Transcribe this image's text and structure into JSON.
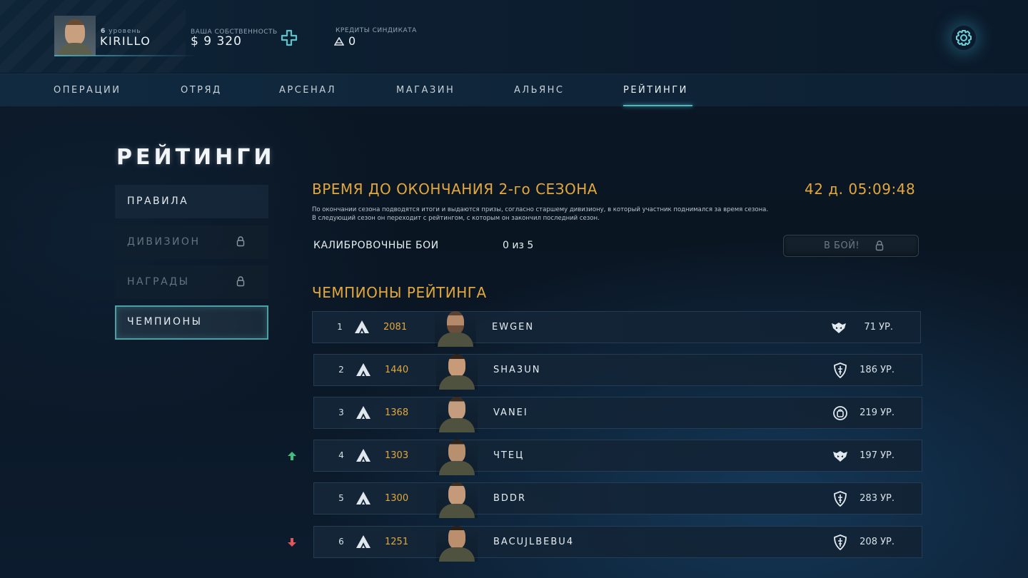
{
  "header": {
    "level_label": "уровень",
    "level_value": "6",
    "player_name": "KIRILLO",
    "property_label": "ВАША СОБСТВЕННОСТЬ",
    "property_value": "$ 9 320",
    "credits_label": "КРЕДИТЫ СИНДИКАТА",
    "credits_value": "0",
    "icons": {
      "add": "plus-icon",
      "credits": "syndicate-credit-icon",
      "settings": "gear-icon"
    }
  },
  "nav": {
    "items": [
      "ОПЕРАЦИИ",
      "ОТРЯД",
      "АРСЕНАЛ",
      "МАГАЗИН",
      "АЛЬЯНС",
      "РЕЙТИНГИ"
    ],
    "active": "РЕЙТИНГИ"
  },
  "page_title": "РЕЙТИНГИ",
  "sidebar": {
    "items": [
      {
        "label": "ПРАВИЛА",
        "state": "normal"
      },
      {
        "label": "ДИВИЗИОН",
        "state": "locked"
      },
      {
        "label": "НАГРАДЫ",
        "state": "locked"
      },
      {
        "label": "ЧЕМПИОНЫ",
        "state": "active"
      }
    ]
  },
  "season": {
    "title": "ВРЕМЯ ДО ОКОНЧАНИЯ 2-го СЕЗОНА",
    "timer": "42 д. 05:09:48",
    "desc_line1": "По окончании сезона подводятся итоги и выдаются призы, согласно старшему дивизиону, в который участник поднимался за время сезона.",
    "desc_line2": "В следующий сезон он переходит с рейтингом, с которым он закончил последний сезон."
  },
  "calibration": {
    "label": "КАЛИБРОВОЧНЫЕ БОИ",
    "value": "0 из 5",
    "fight_button": "В БОЙ!"
  },
  "champions": {
    "title": "ЧЕМПИОНЫ РЕЙТИНГА",
    "rows": [
      {
        "rank": "1",
        "score": "2081",
        "name": "EWGEN",
        "clan_icon": "wolf-emblem-icon",
        "level": "71 УР.",
        "trend": "none"
      },
      {
        "rank": "2",
        "score": "1440",
        "name": "SHA3UN",
        "clan_icon": "dagger-shield-icon",
        "level": "186 УР.",
        "trend": "none"
      },
      {
        "rank": "3",
        "score": "1368",
        "name": "VANEI",
        "clan_icon": "fist-shield-icon",
        "level": "219 УР.",
        "trend": "none"
      },
      {
        "rank": "4",
        "score": "1303",
        "name": "ЧТЕЦ",
        "clan_icon": "wolf-emblem-icon",
        "level": "197 УР.",
        "trend": "up"
      },
      {
        "rank": "5",
        "score": "1300",
        "name": "BDDR",
        "clan_icon": "dagger-shield-icon",
        "level": "283 УР.",
        "trend": "none"
      },
      {
        "rank": "6",
        "score": "1251",
        "name": "BACUJLBEBU4",
        "clan_icon": "dagger-shield-icon",
        "level": "208 УР.",
        "trend": "down"
      }
    ]
  },
  "colors": {
    "accent_gold": "#e2a83c",
    "accent_teal": "#4db6bf",
    "trend_up": "#3fbf7f",
    "trend_down": "#e0565b"
  }
}
